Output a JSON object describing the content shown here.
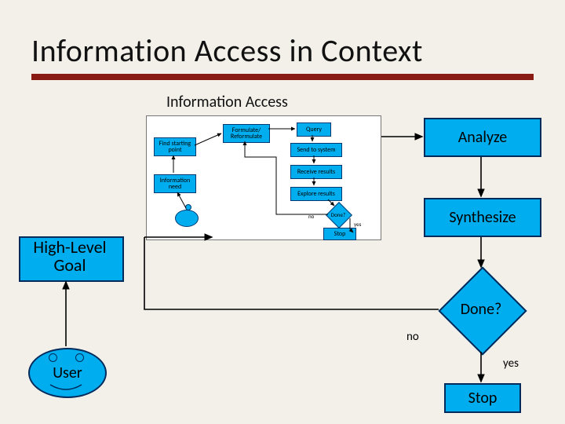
{
  "title": "Information Access in Context",
  "subtitle": "Information Access",
  "right_track": {
    "analyze": "Analyze",
    "synthesize": "Synthesize",
    "done": "Done?",
    "stop": "Stop"
  },
  "edges": {
    "no": "no",
    "yes": "yes"
  },
  "left": {
    "high_level_goal": "High-Level Goal",
    "user": "User"
  },
  "inner": {
    "find_start": "Find starting point",
    "info_need": "Information need",
    "formulate": "Formulate/ Reformulate",
    "query": "Query",
    "send": "Send to system",
    "receive": "Receive results",
    "explore": "Explore results",
    "done": "Done?",
    "stop": "Stop"
  },
  "inner_edges": {
    "no": "no",
    "yes": "yes"
  }
}
